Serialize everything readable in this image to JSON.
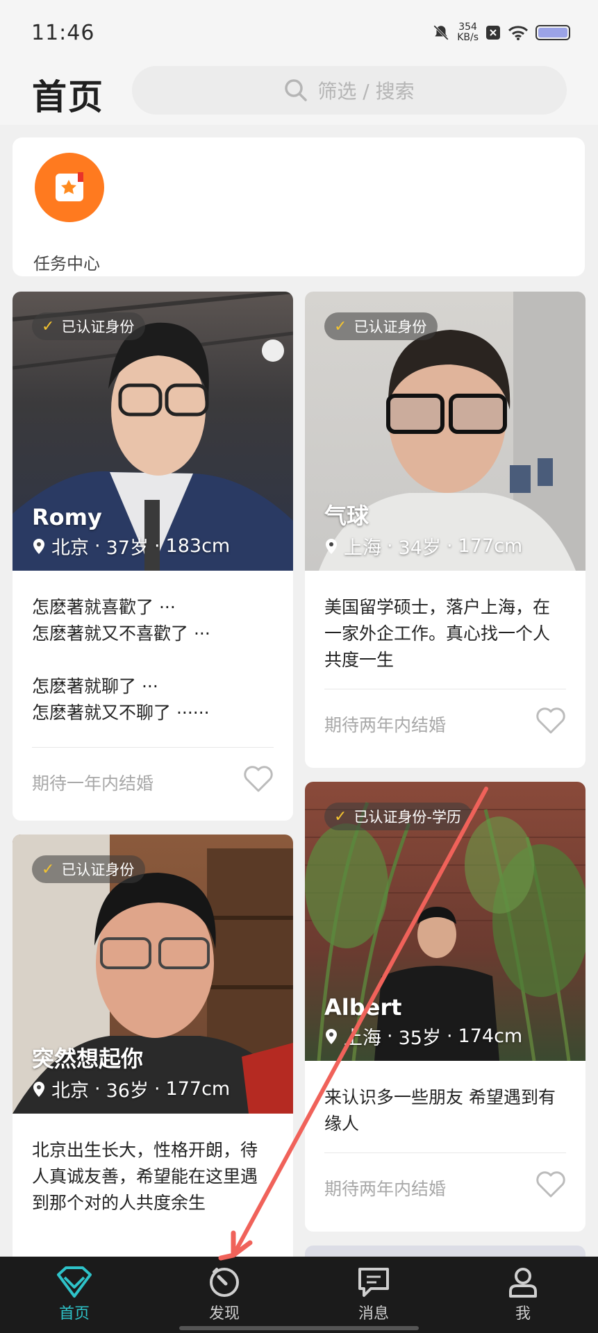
{
  "status_bar": {
    "time": "11:46",
    "net_speed_value": "354",
    "net_speed_unit": "KB/s",
    "icons": [
      "bell-muted-icon",
      "close-box-icon",
      "wifi-icon",
      "battery-icon"
    ]
  },
  "header": {
    "title": "首页",
    "search_placeholder": "筛选 / 搜索"
  },
  "task_center": {
    "label": "任务中心",
    "icon": "task-book-icon",
    "icon_color": "#ff7a1f"
  },
  "profiles": [
    {
      "badge": "已认证身份",
      "name": "Romy",
      "city": "北京",
      "age": "37岁",
      "height": "183cm",
      "bio": "怎麽著就喜歡了 ···\n怎麽著就又不喜歡了 ···\n\n怎麽著就聊了 ···\n怎麽著就又不聊了 ······",
      "expectation": "期待一年内结婚"
    },
    {
      "badge": "已认证身份",
      "name": "气球",
      "city": "上海",
      "age": "34岁",
      "height": "177cm",
      "bio": "美国留学硕士，落户上海，在一家外企工作。真心找一个人共度一生",
      "expectation": "期待两年内结婚"
    },
    {
      "badge": "已认证身份",
      "name": "突然想起你",
      "city": "北京",
      "age": "36岁",
      "height": "177cm",
      "bio": "北京出生长大，性格开朗，待人真诚友善，希望能在这里遇到那个对的人共度余生",
      "expectation": ""
    },
    {
      "badge": "已认证身份-学历",
      "name": "Albert",
      "city": "上海",
      "age": "35岁",
      "height": "174cm",
      "bio": "来认识多一些朋友 希望遇到有缘人",
      "expectation": "期待两年内结婚"
    }
  ],
  "meta_separator": "·",
  "tabs": [
    {
      "label": "首页",
      "icon": "diamond-icon",
      "active": true
    },
    {
      "label": "发现",
      "icon": "compass-icon",
      "active": false
    },
    {
      "label": "消息",
      "icon": "message-icon",
      "active": false
    },
    {
      "label": "我",
      "icon": "profile-icon",
      "active": false
    }
  ],
  "colors": {
    "accent": "#2ec3c9",
    "annotation_arrow": "#f0625a",
    "verify_check": "#f4c430"
  }
}
